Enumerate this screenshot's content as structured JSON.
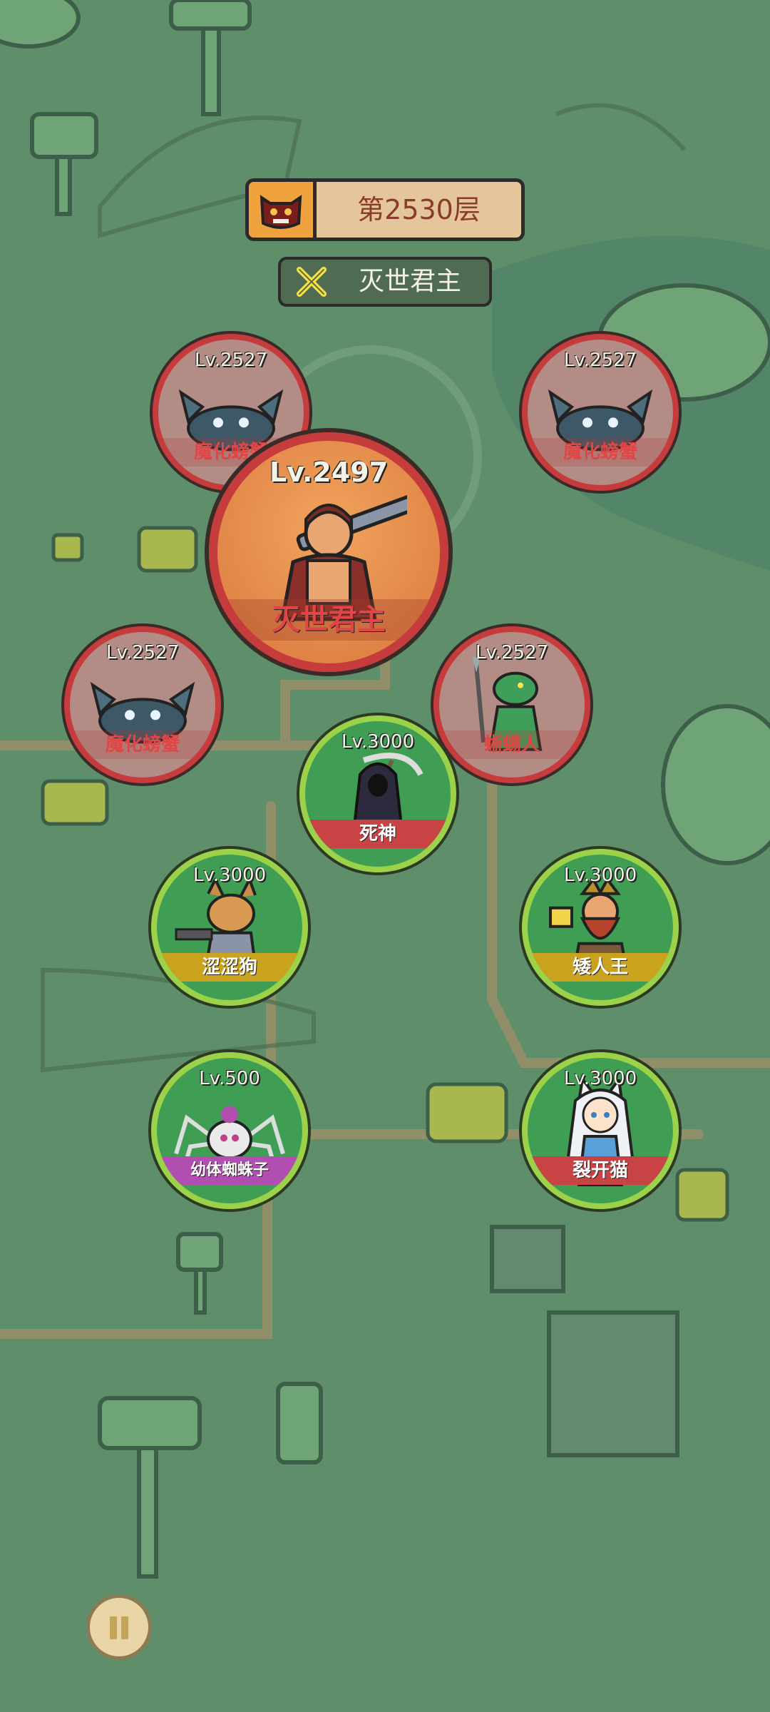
{
  "hud": {
    "floor_label": "第2530层",
    "boss_title": "灭世君主"
  },
  "colors": {
    "enemy_ring": "#c63b3b",
    "ally_ring": "#9bd24a",
    "background": "#5e8f6a",
    "floor_banner": "#e5c59c"
  },
  "enemies": [
    {
      "level": "Lv.2527",
      "name": "魔化螃蟹"
    },
    {
      "level": "Lv.2527",
      "name": "魔化螃蟹"
    },
    {
      "level": "Lv.2497",
      "name": "灭世君主"
    },
    {
      "level": "Lv.2527",
      "name": "魔化螃蟹"
    },
    {
      "level": "Lv.2527",
      "name": "蜥蜴人"
    }
  ],
  "allies": [
    {
      "level": "Lv.3000",
      "name": "死神",
      "banner_color": "#c84444"
    },
    {
      "level": "Lv.3000",
      "name": "涩涩狗",
      "banner_color": "#c9a21e"
    },
    {
      "level": "Lv.3000",
      "name": "矮人王",
      "banner_color": "#c9a21e"
    },
    {
      "level": "Lv.500",
      "name": "幼体蜘蛛子",
      "banner_color": "#b04fb0"
    },
    {
      "level": "Lv.3000",
      "name": "裂开猫",
      "banner_color": "#c84444"
    }
  ],
  "controls": {
    "pause_icon": "pause-icon"
  }
}
